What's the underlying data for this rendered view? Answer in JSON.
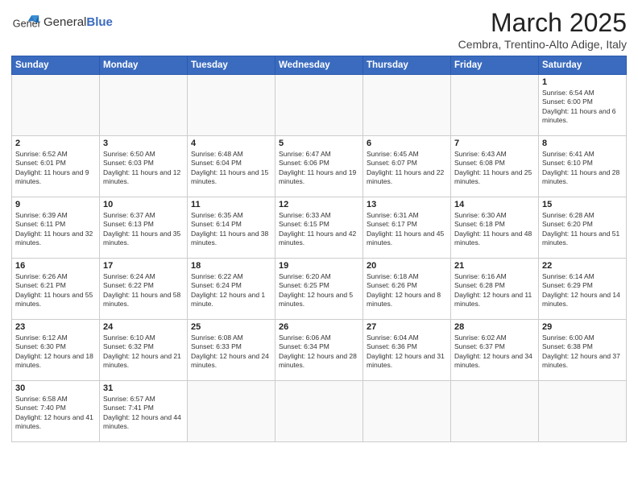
{
  "header": {
    "logo_text_normal": "General",
    "logo_text_bold": "Blue",
    "main_title": "March 2025",
    "subtitle": "Cembra, Trentino-Alto Adige, Italy"
  },
  "days_of_week": [
    "Sunday",
    "Monday",
    "Tuesday",
    "Wednesday",
    "Thursday",
    "Friday",
    "Saturday"
  ],
  "weeks": [
    [
      {
        "day": "",
        "info": ""
      },
      {
        "day": "",
        "info": ""
      },
      {
        "day": "",
        "info": ""
      },
      {
        "day": "",
        "info": ""
      },
      {
        "day": "",
        "info": ""
      },
      {
        "day": "",
        "info": ""
      },
      {
        "day": "1",
        "info": "Sunrise: 6:54 AM\nSunset: 6:00 PM\nDaylight: 11 hours and 6 minutes."
      }
    ],
    [
      {
        "day": "2",
        "info": "Sunrise: 6:52 AM\nSunset: 6:01 PM\nDaylight: 11 hours and 9 minutes."
      },
      {
        "day": "3",
        "info": "Sunrise: 6:50 AM\nSunset: 6:03 PM\nDaylight: 11 hours and 12 minutes."
      },
      {
        "day": "4",
        "info": "Sunrise: 6:48 AM\nSunset: 6:04 PM\nDaylight: 11 hours and 15 minutes."
      },
      {
        "day": "5",
        "info": "Sunrise: 6:47 AM\nSunset: 6:06 PM\nDaylight: 11 hours and 19 minutes."
      },
      {
        "day": "6",
        "info": "Sunrise: 6:45 AM\nSunset: 6:07 PM\nDaylight: 11 hours and 22 minutes."
      },
      {
        "day": "7",
        "info": "Sunrise: 6:43 AM\nSunset: 6:08 PM\nDaylight: 11 hours and 25 minutes."
      },
      {
        "day": "8",
        "info": "Sunrise: 6:41 AM\nSunset: 6:10 PM\nDaylight: 11 hours and 28 minutes."
      }
    ],
    [
      {
        "day": "9",
        "info": "Sunrise: 6:39 AM\nSunset: 6:11 PM\nDaylight: 11 hours and 32 minutes."
      },
      {
        "day": "10",
        "info": "Sunrise: 6:37 AM\nSunset: 6:13 PM\nDaylight: 11 hours and 35 minutes."
      },
      {
        "day": "11",
        "info": "Sunrise: 6:35 AM\nSunset: 6:14 PM\nDaylight: 11 hours and 38 minutes."
      },
      {
        "day": "12",
        "info": "Sunrise: 6:33 AM\nSunset: 6:15 PM\nDaylight: 11 hours and 42 minutes."
      },
      {
        "day": "13",
        "info": "Sunrise: 6:31 AM\nSunset: 6:17 PM\nDaylight: 11 hours and 45 minutes."
      },
      {
        "day": "14",
        "info": "Sunrise: 6:30 AM\nSunset: 6:18 PM\nDaylight: 11 hours and 48 minutes."
      },
      {
        "day": "15",
        "info": "Sunrise: 6:28 AM\nSunset: 6:20 PM\nDaylight: 11 hours and 51 minutes."
      }
    ],
    [
      {
        "day": "16",
        "info": "Sunrise: 6:26 AM\nSunset: 6:21 PM\nDaylight: 11 hours and 55 minutes."
      },
      {
        "day": "17",
        "info": "Sunrise: 6:24 AM\nSunset: 6:22 PM\nDaylight: 11 hours and 58 minutes."
      },
      {
        "day": "18",
        "info": "Sunrise: 6:22 AM\nSunset: 6:24 PM\nDaylight: 12 hours and 1 minute."
      },
      {
        "day": "19",
        "info": "Sunrise: 6:20 AM\nSunset: 6:25 PM\nDaylight: 12 hours and 5 minutes."
      },
      {
        "day": "20",
        "info": "Sunrise: 6:18 AM\nSunset: 6:26 PM\nDaylight: 12 hours and 8 minutes."
      },
      {
        "day": "21",
        "info": "Sunrise: 6:16 AM\nSunset: 6:28 PM\nDaylight: 12 hours and 11 minutes."
      },
      {
        "day": "22",
        "info": "Sunrise: 6:14 AM\nSunset: 6:29 PM\nDaylight: 12 hours and 14 minutes."
      }
    ],
    [
      {
        "day": "23",
        "info": "Sunrise: 6:12 AM\nSunset: 6:30 PM\nDaylight: 12 hours and 18 minutes."
      },
      {
        "day": "24",
        "info": "Sunrise: 6:10 AM\nSunset: 6:32 PM\nDaylight: 12 hours and 21 minutes."
      },
      {
        "day": "25",
        "info": "Sunrise: 6:08 AM\nSunset: 6:33 PM\nDaylight: 12 hours and 24 minutes."
      },
      {
        "day": "26",
        "info": "Sunrise: 6:06 AM\nSunset: 6:34 PM\nDaylight: 12 hours and 28 minutes."
      },
      {
        "day": "27",
        "info": "Sunrise: 6:04 AM\nSunset: 6:36 PM\nDaylight: 12 hours and 31 minutes."
      },
      {
        "day": "28",
        "info": "Sunrise: 6:02 AM\nSunset: 6:37 PM\nDaylight: 12 hours and 34 minutes."
      },
      {
        "day": "29",
        "info": "Sunrise: 6:00 AM\nSunset: 6:38 PM\nDaylight: 12 hours and 37 minutes."
      }
    ],
    [
      {
        "day": "30",
        "info": "Sunrise: 6:58 AM\nSunset: 7:40 PM\nDaylight: 12 hours and 41 minutes."
      },
      {
        "day": "31",
        "info": "Sunrise: 6:57 AM\nSunset: 7:41 PM\nDaylight: 12 hours and 44 minutes."
      },
      {
        "day": "",
        "info": ""
      },
      {
        "day": "",
        "info": ""
      },
      {
        "day": "",
        "info": ""
      },
      {
        "day": "",
        "info": ""
      },
      {
        "day": "",
        "info": ""
      }
    ]
  ]
}
